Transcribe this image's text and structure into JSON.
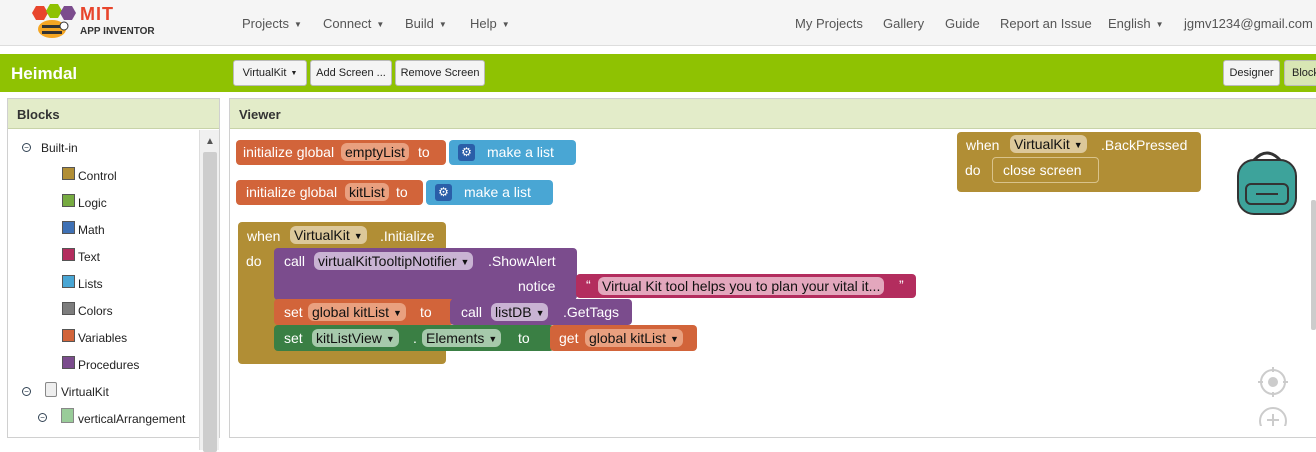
{
  "logo": {
    "line1": "MIT",
    "line2": "APP INVENTOR"
  },
  "topnav": {
    "projects": "Projects",
    "connect": "Connect",
    "build": "Build",
    "help": "Help",
    "my_projects": "My Projects",
    "gallery": "Gallery",
    "guide": "Guide",
    "report_issue": "Report an Issue",
    "language": "English",
    "account": "jgmv1234@gmail.com"
  },
  "project": {
    "name": "Heimdal",
    "screen_select": "VirtualKit",
    "add_screen": "Add Screen ...",
    "remove_screen": "Remove Screen",
    "designer": "Designer",
    "blocks": "Blocks"
  },
  "blocks_panel": {
    "title": "Blocks",
    "builtin": "Built-in",
    "items": [
      "Control",
      "Logic",
      "Math",
      "Text",
      "Lists",
      "Colors",
      "Variables",
      "Procedures"
    ],
    "component_root": "VirtualKit",
    "component_child": "verticalArrangement"
  },
  "colors": {
    "control": "#b18e35",
    "logic": "#77ab41",
    "math": "#3f71b5",
    "text": "#b32d5e",
    "lists": "#49a6d4",
    "colors": "#7d7d7d",
    "variables": "#d2643a",
    "procedures": "#7b4c8d",
    "green_bar": "#8fc202"
  },
  "viewer": {
    "title": "Viewer",
    "b1": {
      "init": "initialize global",
      "name": "emptyList",
      "to": "to",
      "make_list": "make a list"
    },
    "b2": {
      "init": "initialize global",
      "name": "kitList",
      "to": "to",
      "make_list": "make a list"
    },
    "b3": {
      "when": "when",
      "component": "VirtualKit",
      "event": ".Initialize",
      "do": "do",
      "call": "call",
      "notifier": "virtualKitTooltipNotifier",
      "method": ".ShowAlert",
      "notice": "notice",
      "open_quote": "“",
      "text": "Virtual Kit tool helps you to plan your vital it...",
      "close_quote": "”",
      "set": "set",
      "gvar": "global kitList",
      "to": "to",
      "call2": "call",
      "db": "listDB",
      "get_tags": ".GetTags",
      "set2": "set",
      "list_view": "kitListView",
      "dot": ".",
      "elements": "Elements",
      "to2": "to",
      "get": "get",
      "gvar2": "global kitList"
    },
    "b4": {
      "when": "when",
      "component": "VirtualKit",
      "event": ".BackPressed",
      "do": "do",
      "close_screen": "close screen"
    }
  }
}
